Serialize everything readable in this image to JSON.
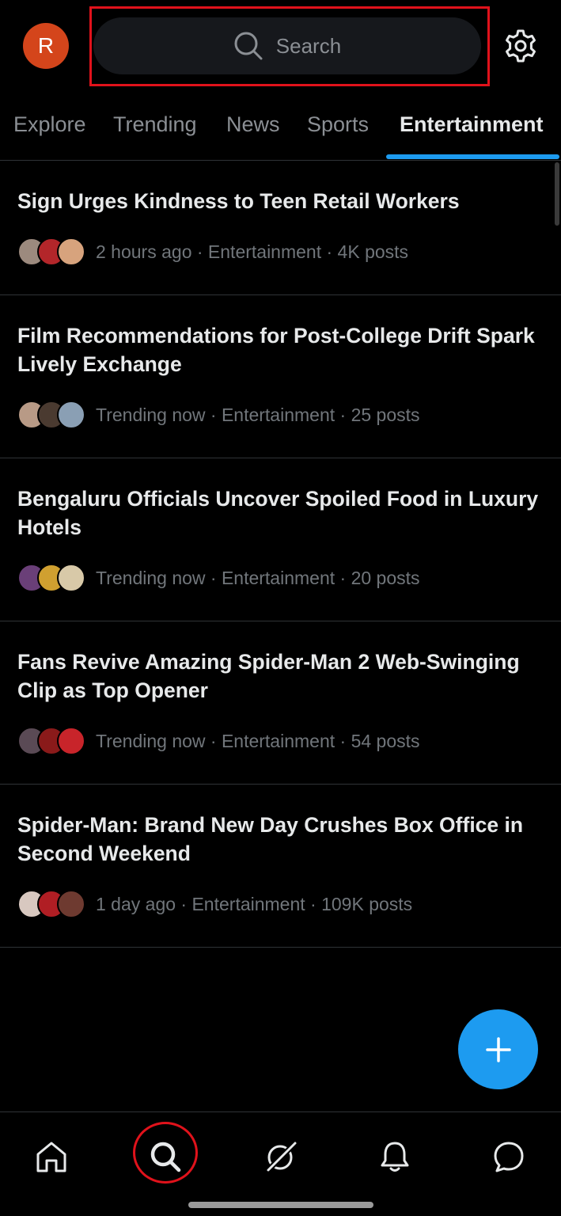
{
  "header": {
    "avatar_letter": "R",
    "search_placeholder": "Search"
  },
  "tabs": [
    {
      "label": "Explore",
      "active": false
    },
    {
      "label": "Trending",
      "active": false
    },
    {
      "label": "News",
      "active": false
    },
    {
      "label": "Sports",
      "active": false
    },
    {
      "label": "Entertainment",
      "active": true
    }
  ],
  "trends": [
    {
      "title": "Sign Urges Kindness to Teen Retail Workers",
      "meta": "2 hours ago · Entertainment · 4K posts"
    },
    {
      "title": "Film Recommendations for Post-College Drift Spark Lively Exchange",
      "meta": "Trending now · Entertainment · 25 posts"
    },
    {
      "title": "Bengaluru Officials Uncover Spoiled Food in Luxury Hotels",
      "meta": "Trending now · Entertainment · 20 posts"
    },
    {
      "title": "Fans Revive Amazing Spider-Man 2 Web-Swinging Clip as Top Opener",
      "meta": "Trending now · Entertainment · 54 posts"
    },
    {
      "title": "Spider-Man: Brand New Day Crushes Box Office in Second Weekend",
      "meta": "1 day ago · Entertainment · 109K posts"
    }
  ],
  "bottom_nav": [
    {
      "name": "home-icon",
      "active": false
    },
    {
      "name": "search-icon",
      "active": true
    },
    {
      "name": "grok-icon",
      "active": false
    },
    {
      "name": "bell-icon",
      "active": false
    },
    {
      "name": "messages-icon",
      "active": false
    }
  ],
  "colors": {
    "background": "#000000",
    "accent": "#1d9bf0",
    "avatar": "#d4451b",
    "highlight": "#e0121b"
  }
}
